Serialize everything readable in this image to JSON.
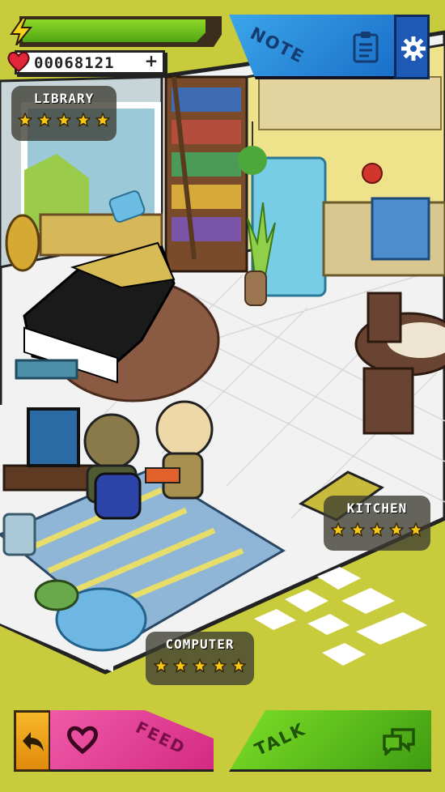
{
  "hud": {
    "hearts_value": "00068121",
    "hearts_add_label": "+",
    "energy_icon": "lightning-icon",
    "hearts_icon": "heart-icon",
    "energy_level": 0.95
  },
  "note_button": {
    "label": "NOTE",
    "icon": "clipboard-icon"
  },
  "settings_button": {
    "icon": "gear-icon"
  },
  "rooms": {
    "library": {
      "label": "LIBRARY",
      "stars": 5
    },
    "kitchen": {
      "label": "KITCHEN",
      "stars": 5
    },
    "computer": {
      "label": "COMPUTER",
      "stars": 5
    }
  },
  "bottom_bar": {
    "back_icon": "back-arrow-icon",
    "feed_label": "FEED",
    "feed_icon": "heart-outline-icon",
    "talk_label": "TALK",
    "talk_icon": "chat-bubbles-icon"
  },
  "colors": {
    "background": "#c8cc3c",
    "energy": "#6cc01c",
    "note": "#2a8ad8",
    "feed": "#e24596",
    "talk": "#5cbc1c",
    "back": "#f0a31c"
  }
}
